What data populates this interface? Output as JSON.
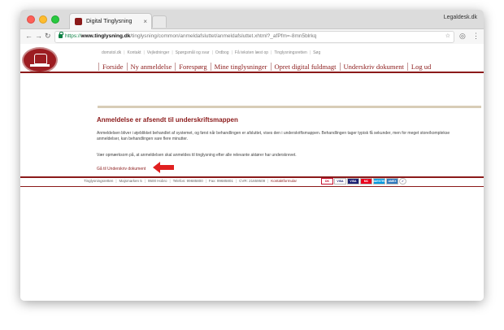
{
  "browser": {
    "tab_title": "Digital Tinglysning",
    "tab_close": "×",
    "profile_name": "Legaldesk.dk",
    "url_scheme": "https://",
    "url_host": "www.tinglysning.dk",
    "url_path": "/tinglysning/common/anmeldafsluttet/anmeldafsluttet.xhtml?_afPfm=-8mn5blrkq"
  },
  "site": {
    "top_links": [
      "domstol.dk",
      "Kontakt",
      "Vejledninger",
      "Spørgsmål og svar",
      "Ordbog",
      "Få teksten læst op",
      "Tinglysningsretten",
      "Søg"
    ],
    "nav": [
      "Forside",
      "Ny anmeldelse",
      "Forespørg",
      "Mine tinglysninger",
      "Opret digital fuldmagt",
      "Underskriv dokument",
      "Log ud"
    ]
  },
  "content": {
    "heading": "Anmeldelse er afsendt til underskriftsmappen",
    "paragraph1": "Anmeldelsen bliver i øjeblikket behandlet af systemet, og først når behandlingen er afsluttet, vises den i underskriftsmappen. Behandlingen tager typisk få sekunder, men for meget store/komplekse anmeldelser, kan behandlingen vare flere minutter.",
    "paragraph2": "Vær opmærksom på, at anmeldelsen skal anmeldes til tinglysning efter alle relevante aktører har underskrevet.",
    "action_link": "Gå til Underskriv dokument"
  },
  "footer": {
    "items": [
      "Tinglysningsretten",
      "Majsmarken 5",
      "9500 Hobro",
      "Telefon: 99685800",
      "Fax: 99685801",
      "CVR: 21659509"
    ],
    "contact_link": "Kontaktformular",
    "payments": [
      "DK",
      "VISA",
      "VISA",
      "MC",
      "MAESTRO",
      "AMEX",
      "✓"
    ]
  },
  "colors": {
    "brand": "#8b1a1a",
    "accent_arrow": "#e02020"
  }
}
